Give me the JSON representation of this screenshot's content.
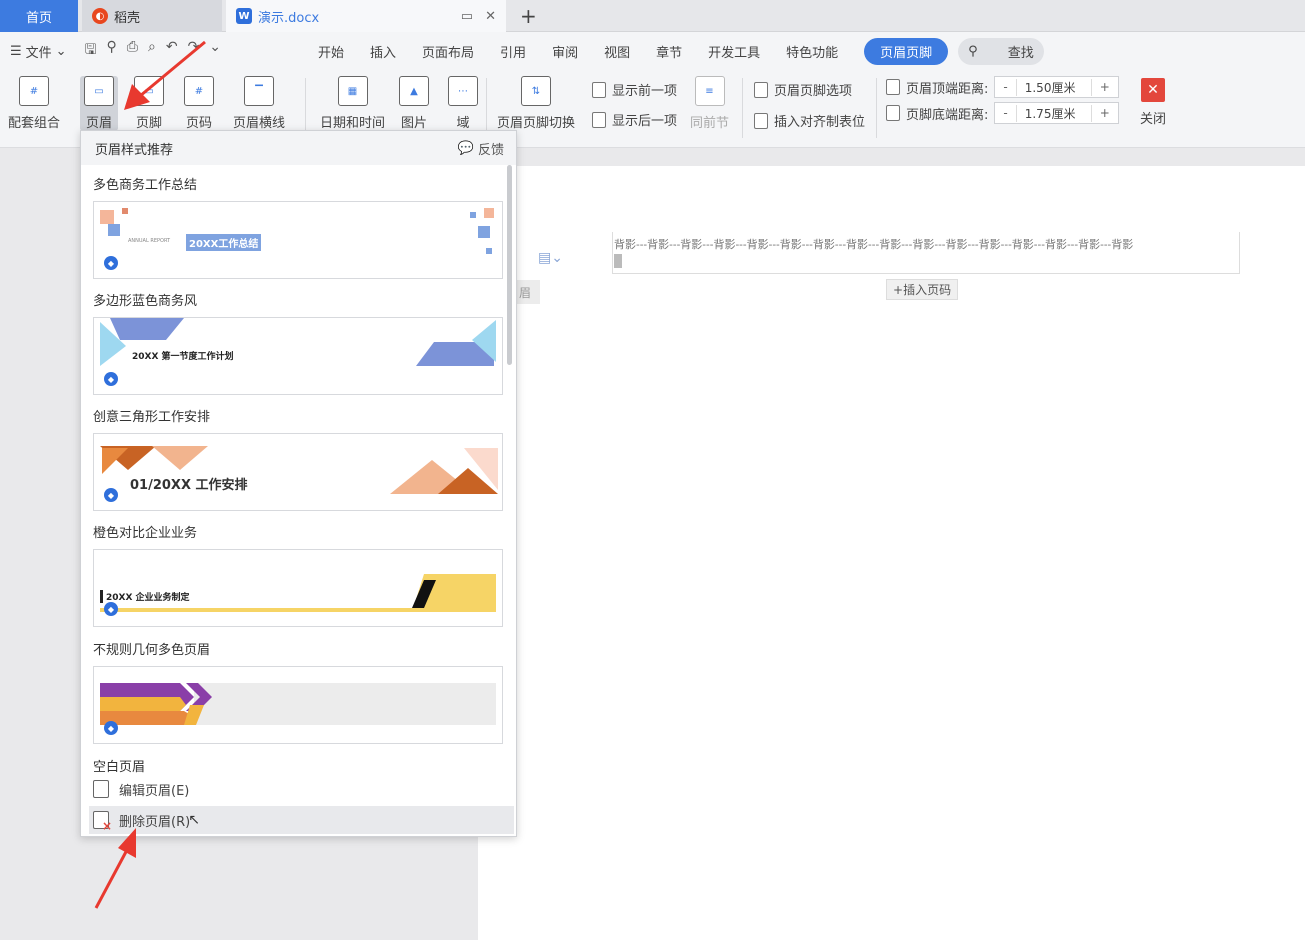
{
  "tabs": {
    "home": "首页",
    "daoke": "稻壳",
    "doc": "演示.docx",
    "new_tab": "+"
  },
  "menu": {
    "file": "文件",
    "items": [
      "开始",
      "插入",
      "页面布局",
      "引用",
      "审阅",
      "视图",
      "章节",
      "开发工具",
      "特色功能"
    ],
    "active": "页眉页脚",
    "search": "查找"
  },
  "ribbon": {
    "combo": "配套组合",
    "header": "页眉",
    "footer": "页脚",
    "page_no": "页码",
    "header_line": "页眉横线",
    "datetime": "日期和时间",
    "picture": "图片",
    "field": "域",
    "switch": "页眉页脚切换",
    "show_prev": "显示前一项",
    "show_next": "显示后一项",
    "same_prev": "同前节",
    "options": "页眉页脚选项",
    "align_tab": "插入对齐制表位",
    "top_dist_label": "页眉顶端距离:",
    "top_dist_value": "1.50厘米",
    "bottom_dist_label": "页脚底端距离:",
    "bottom_dist_value": "1.75厘米",
    "close": "关闭"
  },
  "dropdown": {
    "title": "页眉样式推荐",
    "feedback": "反馈",
    "styles": [
      {
        "name": "多色商务工作总结",
        "preview_text": "20XX工作总结",
        "preview_sub": "ANNUAL REPORT"
      },
      {
        "name": "多边形蓝色商务风",
        "preview_text": "20XX 第一节度工作计划"
      },
      {
        "name": "创意三角形工作安排",
        "preview_text": "01/20XX 工作安排"
      },
      {
        "name": "橙色对比企业业务",
        "preview_text": "20XX 企业业务制定"
      },
      {
        "name": "不规则几何多色页眉",
        "preview_text": ""
      }
    ],
    "blank_label": "空白页眉",
    "edit": "编辑页眉(E)",
    "delete": "删除页眉(R)"
  },
  "document": {
    "watermark": "背影---背影---背影---背影---背影---背影---背影---背影---背影---背影---背影---背影---背影---背影---背影---背影",
    "page_tag": "眉",
    "insert_page_no": "插入页码"
  },
  "colors": {
    "accent": "#3d7be0",
    "close": "#e3473c",
    "arrow": "#e8392f"
  }
}
